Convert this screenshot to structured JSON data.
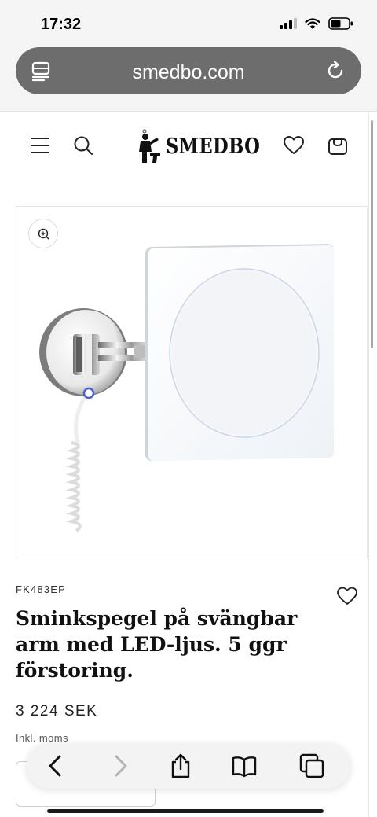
{
  "status_bar": {
    "time": "17:32"
  },
  "browser": {
    "url": "smedbo.com"
  },
  "header": {
    "logo_text": "SMEDBO"
  },
  "product": {
    "sku": "FK483EP",
    "title_lines": [
      "Sminkspegel på svängbar",
      "arm med LED-ljus. 5 ggr",
      "förstoring."
    ],
    "price": "3 224 SEK",
    "vat_note": "Inkl. moms"
  },
  "icons": {
    "menu": "menu-icon",
    "search": "search-icon",
    "wishlist": "heart-icon",
    "cart": "bag-icon",
    "zoom": "zoom-in-icon",
    "reload": "reload-icon",
    "tabs_menu": "page-menu-icon",
    "back": "chevron-left-icon",
    "forward": "chevron-right-icon",
    "share": "share-icon",
    "bookmarks": "book-icon",
    "tabs": "tabs-icon"
  }
}
